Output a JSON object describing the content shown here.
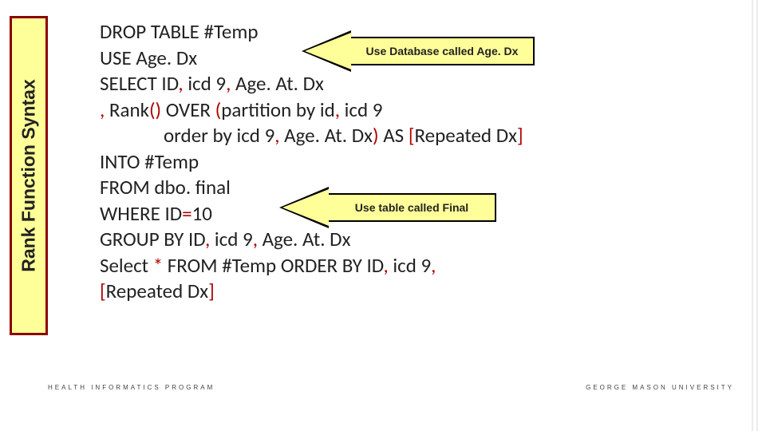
{
  "side_label": "Rank Function Syntax",
  "code": {
    "l1": "DROP TABLE #Temp",
    "l2": "USE Age. Dx",
    "l3a": "SELECT ID",
    "l3b": " icd 9",
    "l3c": " Age. At. Dx",
    "l4a": " Rank",
    "l4b": " OVER ",
    "l4c": "partition by id",
    "l4d": " icd 9",
    "l5a": "order by icd 9",
    "l5b": " Age. At. Dx",
    "l5c": " AS ",
    "l5d": "Repeated Dx",
    "l6": "INTO #Temp",
    "l7": "FROM dbo. final",
    "l8a": "WHERE ID",
    "l8b": "10",
    "l9a": "GROUP BY ID",
    "l9b": " icd 9",
    "l9c": " Age. At. Dx",
    "l10a": "Select ",
    "l10b": " FROM #Temp ORDER BY ID",
    "l10c": " icd 9",
    "l11a": "Repeated Dx"
  },
  "punct": {
    "comma": ",",
    "open_p": "(",
    "close_p": ")",
    "open_b": "[",
    "close_b": "]",
    "eq": "=",
    "star": "*",
    "empty": "()"
  },
  "arrow1": "Use Database called Age. Dx",
  "arrow2": "Use table called Final",
  "footer_left": "HEALTH INFORMATICS PROGRAM",
  "footer_right": "GEORGE MASON UNIVERSITY"
}
